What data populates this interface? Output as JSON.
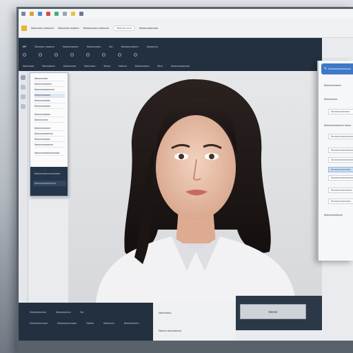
{
  "tabbar": {
    "items": [
      "",
      "",
      "",
      "",
      "",
      "",
      "",
      ""
    ]
  },
  "urlbar": {
    "bookmarks": [
      "Nnnnnnn nnnnnnn",
      "Nnnnnnn nnnnnn",
      "Nnnnnnnnn nnnnnnn",
      "Nnnnnnnnnnnn"
    ],
    "url": "Nnnnnn nnn"
  },
  "navbar": {
    "row1": [
      "RF",
      "Nnnnnn nnnnnn",
      "Nnnnnnnnnn",
      "Nnnnnnnnn",
      "Nn",
      "Nnnnnnnnnnn",
      "Nnnnnnn"
    ],
    "row2": [
      "Nnnnnnn",
      "Nnnnnnnn",
      "Nnnnnnnn",
      "Nnnnnnn",
      "Nnnn",
      "Nnnnn",
      "Nnnnnnnnn",
      "Nnn",
      "Nnnnnnnnnnnn"
    ]
  },
  "menu": {
    "items": [
      "Nnnnnnnnnn",
      "Nnnnnnnnnnnnn",
      "Nnnnnnnnnnnnnnn",
      "Nnnnnnnnnnnn",
      "Nnnnnnnnnnnn",
      "Nnnnnnnnnnnn",
      "Nnnnnnnnnnnn",
      "Nnnnnnnnnn",
      "Nnnnnnnnnnnn",
      "Nnnnnnnnnnnnnn",
      "Nnnnnnnnnnnn",
      "Nnnnnnnnnnnnnn",
      "Nnnnnnnnnnnnnnnnnnn"
    ],
    "footer": [
      "Nnnnnnnnnn nnnnnnnnn",
      "Nnnnnnnnnnnnnnnn"
    ]
  },
  "bottombar": {
    "row1": [
      "Nnnnnnnnnnn",
      "Nnnnnnnnnn",
      "Nn"
    ],
    "row2": [
      "Nnnnnnnnnnnn",
      "Nnnnnnnnnnnnn",
      "Nnnnn",
      "Nnnnnnn",
      "Nnnnnnnnnn"
    ]
  },
  "bottom_mid": {
    "lines": [
      "Nnnnnnnn",
      "Nnnnn nnnnnnnnn",
      "Nnnnnn nnnnnnnnnnn"
    ]
  },
  "bottom_right": {
    "button_label": "Nnnnn"
  },
  "side": {
    "header": "Nnnnnnnnnnnnnnnn",
    "labels": [
      "Nnnnnnnnnnnnn",
      "Nnnnnnnnnn",
      "Nnnnnnnnnnnnnn",
      "Nnnnnnnnnnnnnnn nnnnn"
    ],
    "boxes": [
      "Nnnnnnnnnnnnnnn",
      "Nnnnnnnnnnnnnnnnnnn",
      "Nnnnnnnnnnnnnnnnnnnn",
      "Nnnnnnnnnnnnnnnnnnn",
      "Nnnnnnnnnnnnnnnn",
      "Nnnnnnnnnnnnnnnnnnn",
      "Nnnnnnnnnnnnnnnnn",
      "Nnnnnnnnnnnnnnnn"
    ]
  },
  "colors": {
    "navbar": "#23303f",
    "accent": "#3e78c9",
    "photo_bg": "#e0e1e3"
  },
  "icons": {
    "app_logo": "folder-icon",
    "tool_strip": [
      "cursor-icon",
      "brush-icon",
      "crop-icon",
      "layers-icon"
    ]
  }
}
